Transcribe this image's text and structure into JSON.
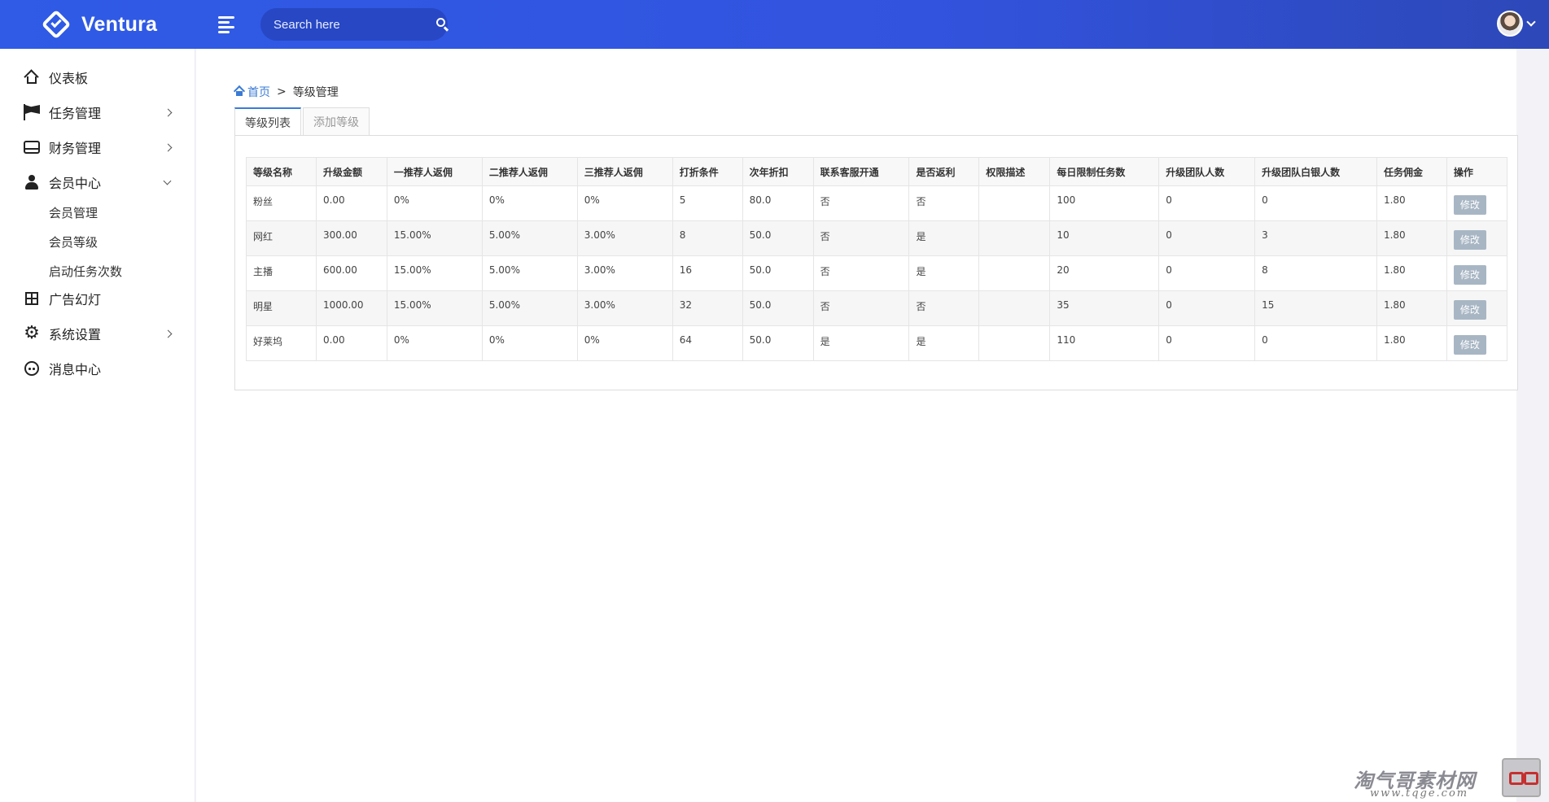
{
  "brand": {
    "name": "Ventura"
  },
  "search": {
    "placeholder": "Search here"
  },
  "sidebar": {
    "items": [
      {
        "label": "仪表板",
        "icon": "home-icon"
      },
      {
        "label": "任务管理",
        "icon": "flag-icon"
      },
      {
        "label": "财务管理",
        "icon": "drive-icon"
      },
      {
        "label": "会员中心",
        "icon": "user-icon"
      },
      {
        "label": "广告幻灯",
        "icon": "grid-icon"
      },
      {
        "label": "系统设置",
        "icon": "gear-icon"
      },
      {
        "label": "消息中心",
        "icon": "chat-icon"
      }
    ],
    "subitems": [
      "会员管理",
      "会员等级",
      "启动任务次数"
    ]
  },
  "breadcrumb": {
    "home": "首页",
    "separator": ">",
    "current": "等级管理"
  },
  "tabs": [
    "等级列表",
    "添加等级"
  ],
  "table": {
    "headers": [
      "等级名称",
      "升级金额",
      "一推荐人返佣",
      "二推荐人返佣",
      "三推荐人返佣",
      "打折条件",
      "次年折扣",
      "联系客服开通",
      "是否返利",
      "权限描述",
      "每日限制任务数",
      "升级团队人数",
      "升级团队白银人数",
      "任务佣金",
      "操作"
    ],
    "rows": [
      [
        "粉丝",
        "0.00",
        "0%",
        "0%",
        "0%",
        "5",
        "80.0",
        "否",
        "否",
        "",
        "100",
        "0",
        "0",
        "1.80"
      ],
      [
        "网红",
        "300.00",
        "15.00%",
        "5.00%",
        "3.00%",
        "8",
        "50.0",
        "否",
        "是",
        "",
        "10",
        "0",
        "3",
        "1.80"
      ],
      [
        "主播",
        "600.00",
        "15.00%",
        "5.00%",
        "3.00%",
        "16",
        "50.0",
        "否",
        "是",
        "",
        "20",
        "0",
        "8",
        "1.80"
      ],
      [
        "明星",
        "1000.00",
        "15.00%",
        "5.00%",
        "3.00%",
        "32",
        "50.0",
        "否",
        "否",
        "",
        "35",
        "0",
        "15",
        "1.80"
      ],
      [
        "好莱坞",
        "0.00",
        "0%",
        "0%",
        "0%",
        "64",
        "50.0",
        "是",
        "是",
        "",
        "110",
        "0",
        "0",
        "1.80"
      ]
    ],
    "edit_label": "修改"
  },
  "watermark": {
    "title": "淘气哥素材网",
    "url": "www.tqge.com"
  },
  "colors": {
    "topbar": "#3055e0",
    "accent": "#3a7bd5",
    "edit_button": "#a8b6c4"
  }
}
